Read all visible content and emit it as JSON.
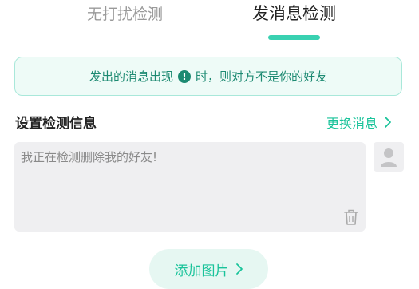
{
  "tabs": {
    "quiet": "无打扰检测",
    "send": "发消息检测"
  },
  "notice": {
    "before": "发出的消息出现",
    "after": "时，则对方不是你的好友"
  },
  "section": {
    "title": "设置检测信息",
    "change_label": "更换消息"
  },
  "message": {
    "text": "我正在检测删除我的好友!"
  },
  "add_image": {
    "label": "添加图片"
  },
  "colors": {
    "accent": "#19c39a",
    "notice_text": "#1d8a72",
    "notice_bg": "#eefbf7",
    "box_bg": "#efeff1"
  },
  "icons": [
    "exclamation-icon",
    "chevron-right-icon",
    "trash-icon",
    "avatar-icon"
  ]
}
